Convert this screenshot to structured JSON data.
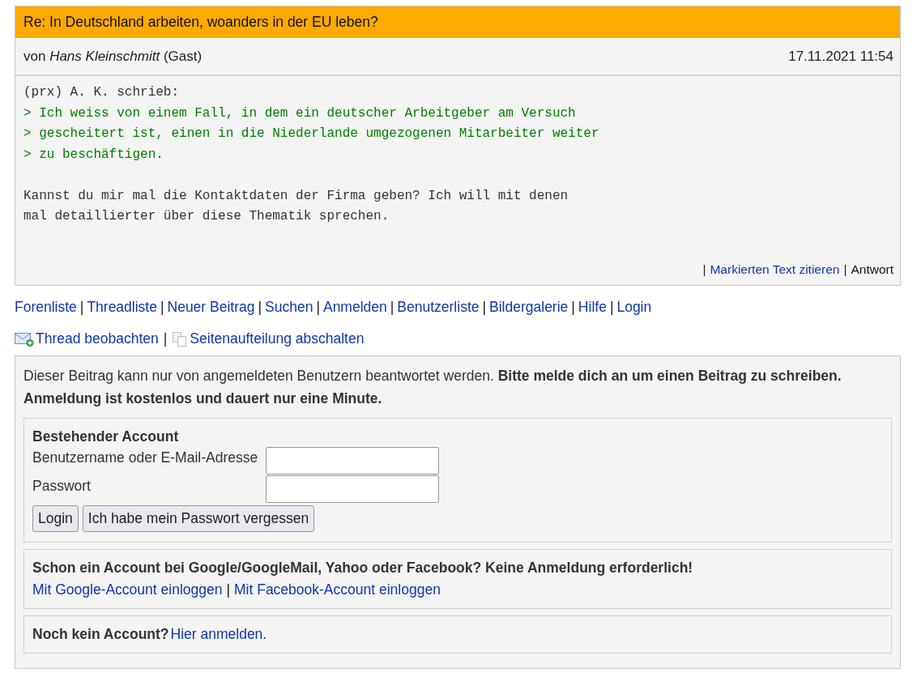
{
  "post": {
    "title": "Re: In Deutschland arbeiten, woanders in der EU leben?",
    "by_prefix": "von",
    "author": "Hans Kleinschmitt",
    "author_note": "(Gast)",
    "date": "17.11.2021 11:54",
    "body": [
      {
        "kind": "attribution",
        "lines": [
          "(prx) A. K. schrieb:"
        ]
      },
      {
        "kind": "quote",
        "lines": [
          "> Ich weiss von einem Fall, in dem ein deutscher Arbeitgeber am Versuch",
          "> gescheitert ist, einen in die Niederlande umgezogenen Mitarbeiter weiter",
          "> zu beschäftigen."
        ]
      },
      {
        "kind": "text",
        "lines": [
          "Kannst du mir mal die Kontaktdaten der Firma geben? Ich will mit denen",
          "mal detaillierter über diese Thematik sprechen."
        ]
      }
    ],
    "separator": "|",
    "actions": [
      {
        "label": "Markierten Text zitieren",
        "kind": "link"
      },
      {
        "label": "Antwort",
        "kind": "plain"
      }
    ]
  },
  "nav": {
    "separator": "|",
    "links": [
      "Forenliste",
      "Threadliste",
      "Neuer Beitrag",
      "Suchen",
      "Anmelden",
      "Benutzerliste",
      "Bildergalerie",
      "Hilfe",
      "Login"
    ]
  },
  "tools": {
    "separator": "|",
    "items": [
      {
        "label": "Thread beobachten",
        "kind": "watch"
      },
      {
        "label": "Seitenaufteilung abschalten",
        "kind": "paging"
      }
    ]
  },
  "login": {
    "notice": "Dieser Beitrag kann nur von angemeldeten Benutzern beantwortet werden. **Bitte melde dich an um einen Beitrag zu schreiben. Anmeldung ist kostenlos und dauert nur eine Minute.**",
    "existing": {
      "heading": "Bestehender Account",
      "fields": [
        {
          "label": "Benutzername oder E-Mail-Adresse"
        },
        {
          "label": "Passwort"
        }
      ],
      "buttons": [
        "Login",
        "Ich habe mein Passwort vergessen"
      ]
    },
    "social": {
      "heading": "Schon ein Account bei Google/GoogleMail, Yahoo oder Facebook? Keine Anmeldung erforderlich!",
      "separator": "|",
      "links": [
        "Mit Google-Account einloggen",
        "Mit Facebook-Account einloggen"
      ]
    },
    "signup": {
      "question": "Noch kein Account?",
      "link": "Hier anmelden."
    }
  }
}
